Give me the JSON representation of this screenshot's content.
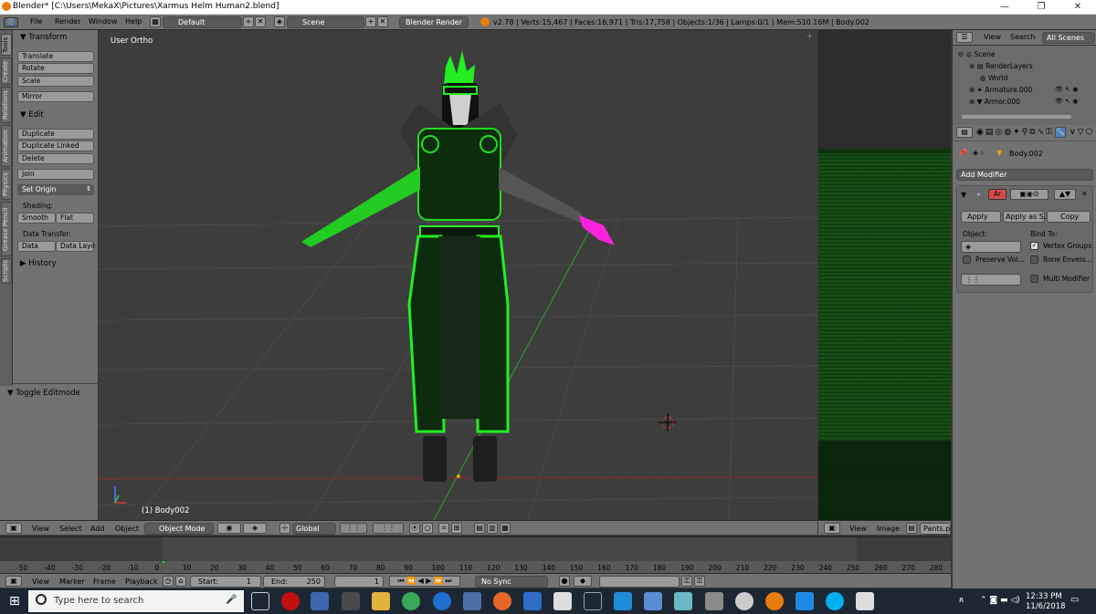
{
  "window": {
    "title": "Blender* [C:\\Users\\MekaX\\Pictures\\Xarmus Helm Human2.blend]",
    "controls": [
      "—",
      "❐",
      "✕"
    ]
  },
  "info_header": {
    "menus": [
      "File",
      "Render",
      "Window",
      "Help"
    ],
    "screen_layout": "Default",
    "scene": "Scene",
    "render_engine": "Blender Render",
    "stats": "v2.78 | Verts:15,467 | Faces:16,971 | Tris:17,758 | Objects:1/36 | Lamps:0/1 | Mem:510.16M | Body.002"
  },
  "tool_tabs": [
    "Tools",
    "Create",
    "Relations",
    "Animation",
    "Physics",
    "Grease Pencil",
    "Scripts"
  ],
  "tool_shelf": {
    "transform_header": "▼ Transform",
    "translate": "Translate",
    "rotate": "Rotate",
    "scale": "Scale",
    "mirror": "Mirror",
    "edit_header": "▼ Edit",
    "duplicate": "Duplicate",
    "duplicate_linked": "Duplicate Linked",
    "delete": "Delete",
    "join": "Join",
    "set_origin": "Set Origin",
    "shading_label": "Shading:",
    "smooth": "Smooth",
    "flat": "Flat",
    "data_transfer_label": "Data Transfer:",
    "data": "Data",
    "data_layout": "Data Layo",
    "history_header": "▶ History",
    "toggle_editmode": "▼ Toggle Editmode"
  },
  "viewport": {
    "view_name": "User Ortho",
    "object_label": "(1) Body002"
  },
  "view3d_header": {
    "menus": [
      "View",
      "Select",
      "Add",
      "Object"
    ],
    "mode": "Object Mode",
    "orientation": "Global"
  },
  "uv_header": {
    "menus": [
      "View",
      "Image"
    ],
    "image": "Pants.p"
  },
  "outliner": {
    "tabs": [
      "View",
      "Search",
      "All Scenes"
    ],
    "items": [
      "Scene",
      "RenderLayers",
      "World",
      "Armature.000",
      "Armor.000"
    ]
  },
  "properties": {
    "object_name": "Body.002",
    "add_modifier": "Add Modifier",
    "modifier_name": "Ar",
    "apply": "Apply",
    "apply_as_shape": "Apply as S..",
    "copy": "Copy",
    "object_label": "Object:",
    "bind_to_label": "Bind To:",
    "vertex_groups": "Vertex Groups",
    "preserve_volume": "Preserve Vol...",
    "bone_envelopes": "Bone Envelo...",
    "multi_modifier": "Multi Modifier"
  },
  "timeline": {
    "ticks": [
      "-50",
      "-40",
      "-30",
      "-20",
      "-10",
      "0",
      "10",
      "20",
      "30",
      "40",
      "50",
      "60",
      "70",
      "80",
      "90",
      "100",
      "110",
      "120",
      "130",
      "140",
      "150",
      "160",
      "170",
      "180",
      "190",
      "200",
      "210",
      "220",
      "230",
      "240",
      "250",
      "260",
      "270",
      "280"
    ],
    "menus": [
      "View",
      "Marker",
      "Frame",
      "Playback"
    ],
    "start_label": "Start:",
    "start_value": "1",
    "end_label": "End:",
    "end_value": "250",
    "current_frame": "1",
    "sync": "No Sync"
  },
  "taskbar": {
    "search_placeholder": "Type here to search",
    "time": "12:33 PM",
    "date": "11/6/2018"
  },
  "colors": {
    "blender_panel": "#727272",
    "viewport_bg": "#3d3d3d",
    "armor_green": "#22dd22",
    "magenta_hand": "#ff22dd"
  }
}
